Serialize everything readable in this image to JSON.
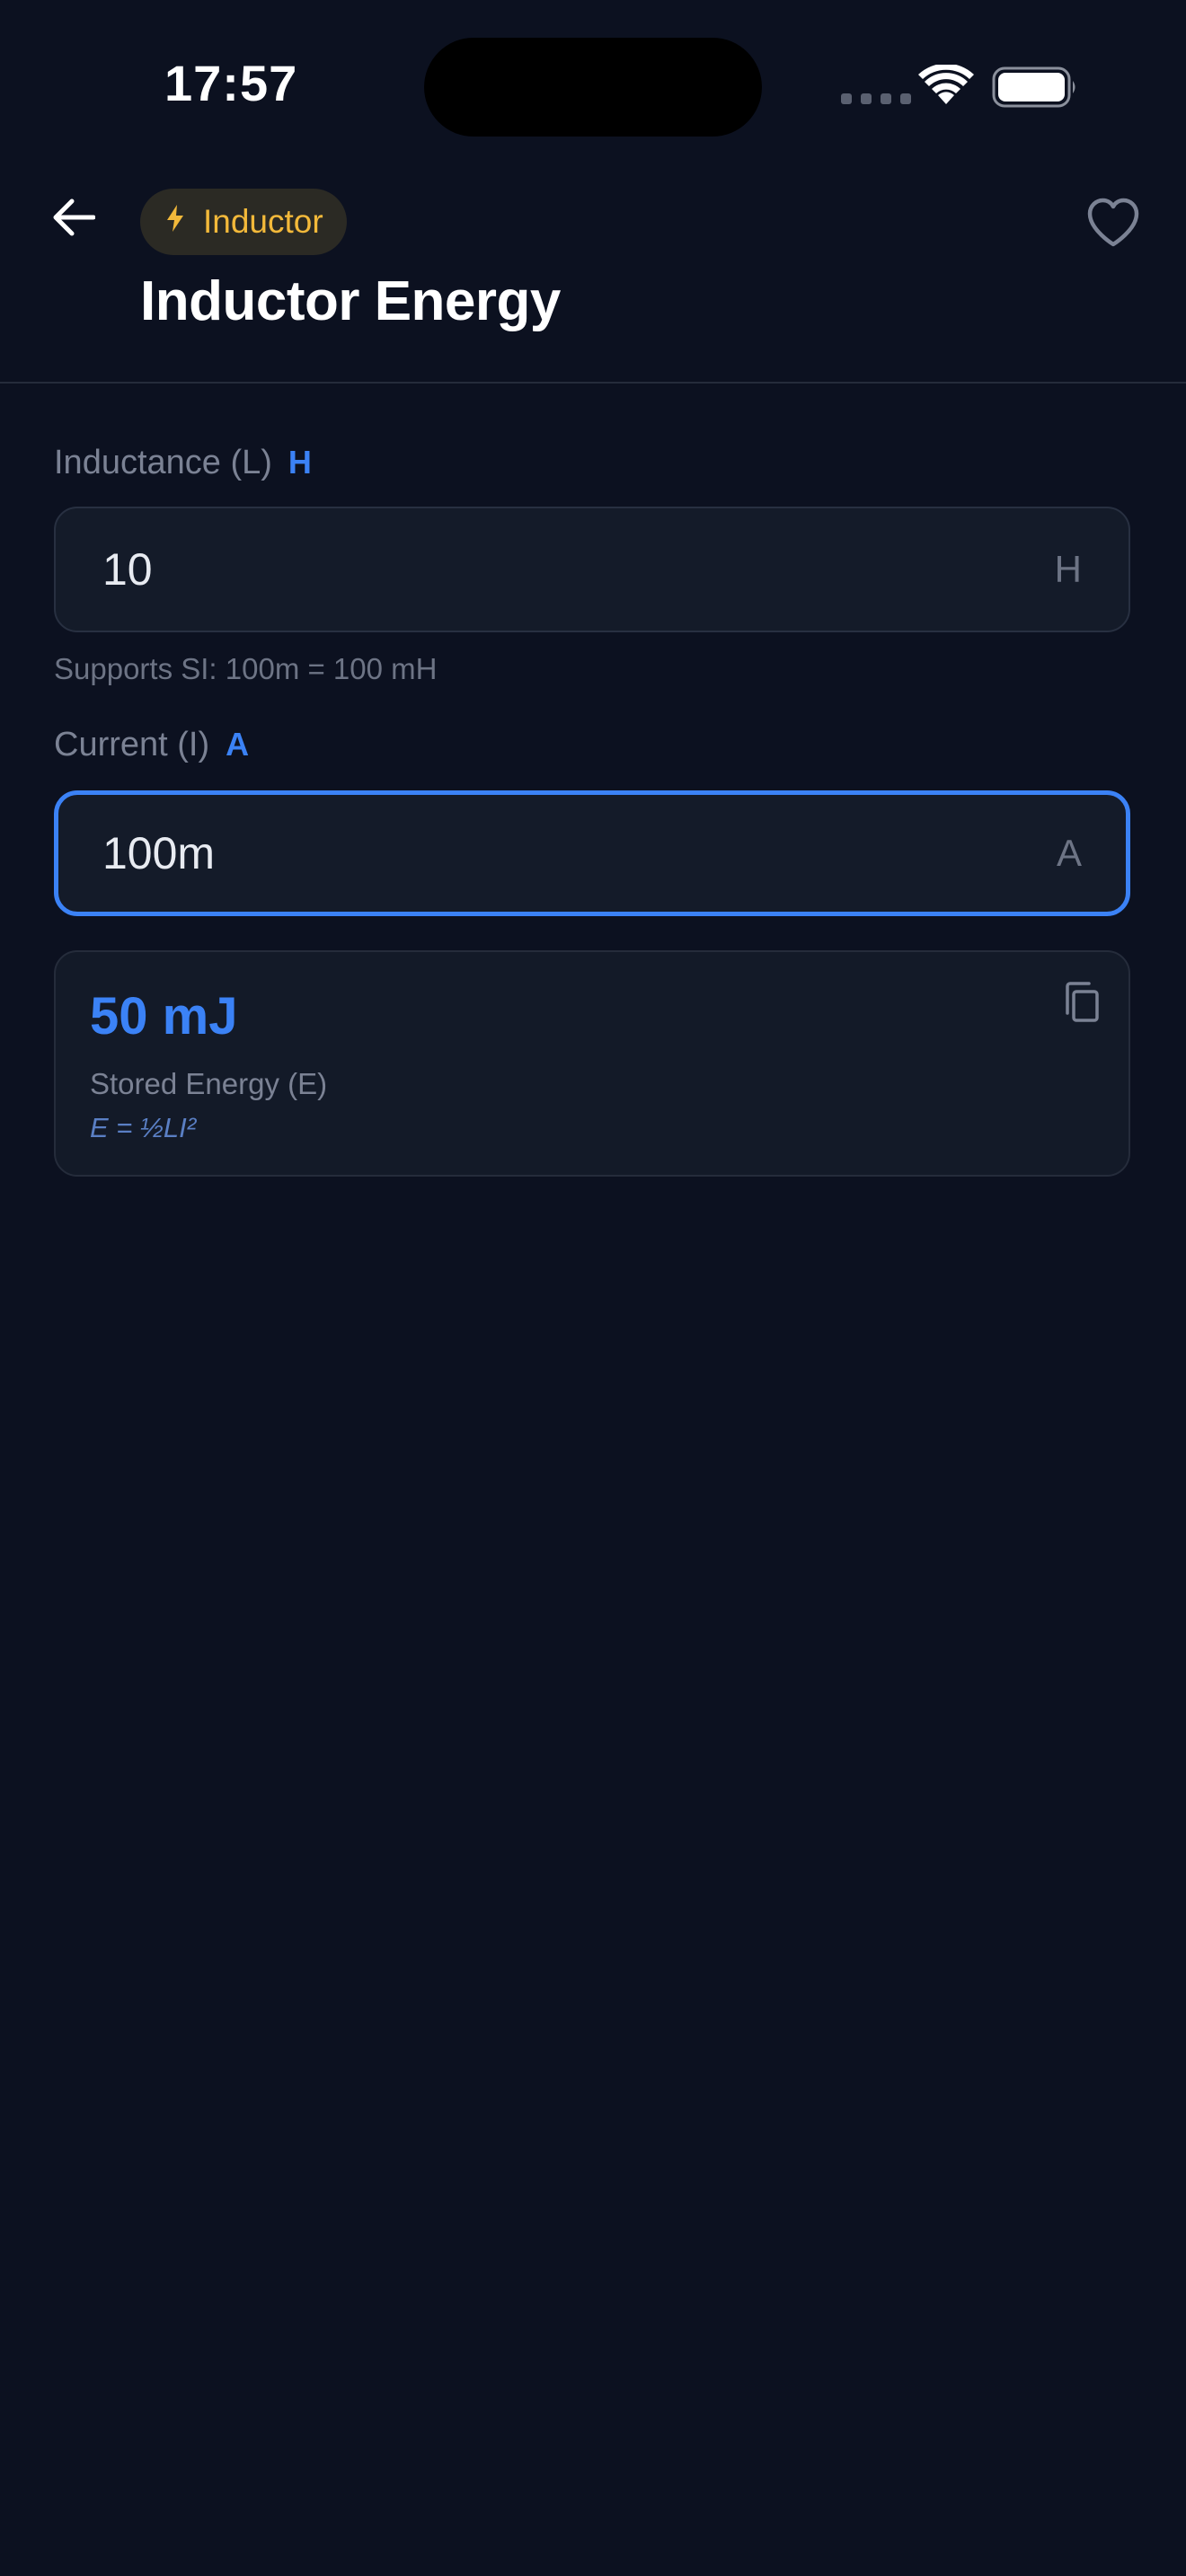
{
  "status_bar": {
    "time": "17:57"
  },
  "header": {
    "back_icon": "arrow-left-icon",
    "category": {
      "icon": "lightning-bolt-icon",
      "label": "Inductor",
      "color": "#f3b93a"
    },
    "favorite_icon": "heart-outline-icon",
    "title": "Inductor Energy"
  },
  "form": {
    "inductance": {
      "label": "Inductance (L)",
      "unit_tag": "H",
      "value": "10",
      "suffix": "H",
      "hint": "Supports SI: 100m = 100 mH"
    },
    "current": {
      "label": "Current (I)",
      "unit_tag": "A",
      "value": "100m",
      "suffix": "A",
      "focused": true
    }
  },
  "result": {
    "value": "50 mJ",
    "label": "Stored Energy (E)",
    "formula": "E = ½LI²",
    "copy_icon": "copy-icon"
  },
  "colors": {
    "background": "#0c1120",
    "accent": "#3b82f6",
    "category_accent": "#f3b93a"
  }
}
